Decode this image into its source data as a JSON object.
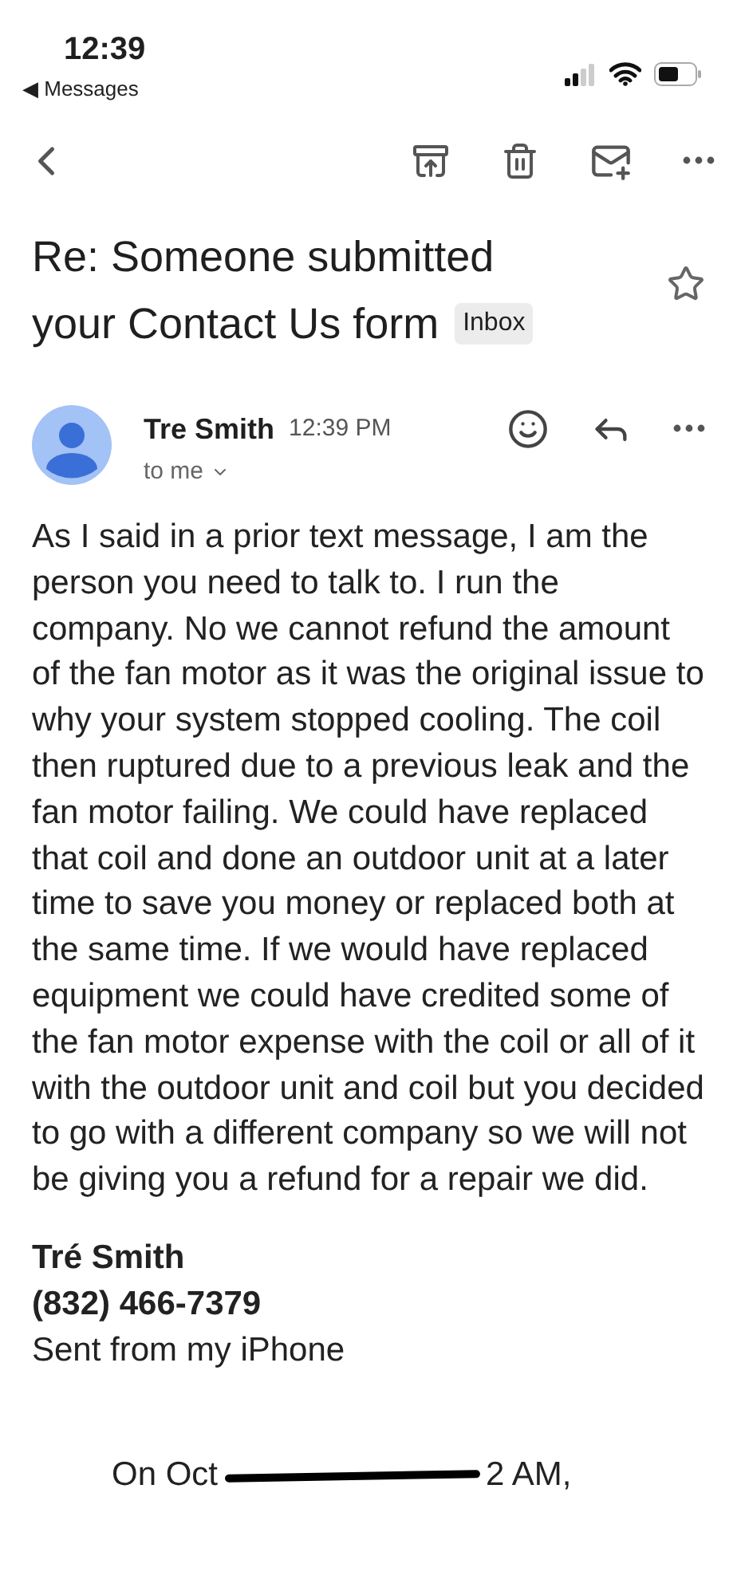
{
  "status_bar": {
    "time": "12:39",
    "back_app": "◀ Messages"
  },
  "subject": [
    "Re: Someone submitted",
    "your Contact Us form"
  ],
  "label": "Inbox",
  "starred": false,
  "message": {
    "sender": "Tre Smith",
    "time": "12:39 PM",
    "recipient": "to me",
    "body": "As I said in a prior text message, I am the person you need to talk to. I run the company. No we cannot refund the amount of the fan motor as it was the original issue to why your system stopped cooling. The coil then ruptured due to a previous leak and the fan motor failing. We could have replaced that coil and done an outdoor unit at a later time to save you money or replaced both at the same time. If we would have replaced equipment we could have credited some of the fan motor expense with the coil or all of it with the outdoor unit and coil but you decided to go with a different company so we will not be giving you a refund for a repair we did.",
    "signature": [
      "Tré Smith",
      "(832) 466-7379"
    ],
    "sent_from": "Sent from my iPhone",
    "quote_header": [
      "On Oct",
      "2 AM,"
    ]
  }
}
